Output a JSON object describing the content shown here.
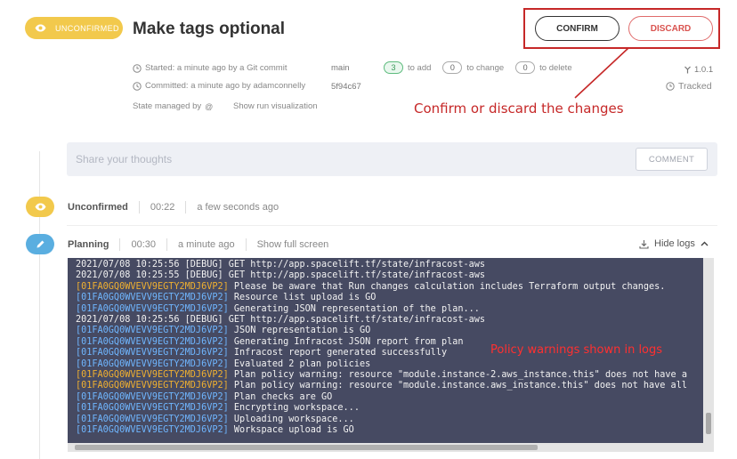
{
  "header": {
    "status": "UNCONFIRMED",
    "title": "Make tags optional",
    "confirm_label": "CONFIRM",
    "discard_label": "DISCARD",
    "annotation": "Confirm or discard the changes"
  },
  "meta": {
    "started": "Started: a minute ago by a Git commit",
    "committed": "Committed: a minute ago by adamconnelly",
    "branch": "main",
    "commit": "5f94c67",
    "state_managed": "State managed by",
    "show_viz": "Show run visualization",
    "add_count": "3",
    "add_label": "to add",
    "change_count": "0",
    "change_label": "to change",
    "delete_count": "0",
    "delete_label": "to delete",
    "version": "1.0.1",
    "tracked": "Tracked"
  },
  "comment": {
    "placeholder": "Share your thoughts",
    "button": "COMMENT"
  },
  "phases": {
    "unconfirmed": {
      "name": "Unconfirmed",
      "duration": "00:22",
      "time": "a few seconds ago"
    },
    "planning": {
      "name": "Planning",
      "duration": "00:30",
      "time": "a minute ago",
      "fullscreen": "Show full screen",
      "hide_logs": "Hide logs"
    }
  },
  "log": {
    "annotation": "Policy warnings shown in logs",
    "lines": [
      {
        "prefix": "2021/07/08 10:25:56 [DEBUG]",
        "kind": "plain",
        "msg": " GET http://app.spacelift.tf/state/infracost-aws"
      },
      {
        "prefix": "2021/07/08 10:25:55 [DEBUG]",
        "kind": "plain",
        "msg": " GET http://app.spacelift.tf/state/infracost-aws"
      },
      {
        "prefix": "[01FA0GQ0WVEVV9EGTY2MDJ6VP2]",
        "kind": "orange",
        "msg": " Please be aware that Run changes calculation includes Terraform output changes."
      },
      {
        "prefix": "[01FA0GQ0WVEVV9EGTY2MDJ6VP2]",
        "kind": "blue",
        "msg": " Resource list upload is GO"
      },
      {
        "prefix": "[01FA0GQ0WVEVV9EGTY2MDJ6VP2]",
        "kind": "blue",
        "msg": " Generating JSON representation of the plan..."
      },
      {
        "prefix": "2021/07/08 10:25:56 [DEBUG]",
        "kind": "plain",
        "msg": " GET http://app.spacelift.tf/state/infracost-aws"
      },
      {
        "prefix": "[01FA0GQ0WVEVV9EGTY2MDJ6VP2]",
        "kind": "blue",
        "msg": " JSON representation is GO"
      },
      {
        "prefix": "[01FA0GQ0WVEVV9EGTY2MDJ6VP2]",
        "kind": "blue",
        "msg": " Generating Infracost JSON report from plan"
      },
      {
        "prefix": "[01FA0GQ0WVEVV9EGTY2MDJ6VP2]",
        "kind": "blue",
        "msg": " Infracost report generated successfully"
      },
      {
        "prefix": "[01FA0GQ0WVEVV9EGTY2MDJ6VP2]",
        "kind": "blue",
        "msg": " Evaluated 2 plan policies"
      },
      {
        "prefix": "[01FA0GQ0WVEVV9EGTY2MDJ6VP2]",
        "kind": "orange",
        "msg": " Plan policy warning: resource \"module.instance-2.aws_instance.this\" does not have a"
      },
      {
        "prefix": "[01FA0GQ0WVEVV9EGTY2MDJ6VP2]",
        "kind": "orange",
        "msg": " Plan policy warning: resource \"module.instance.aws_instance.this\" does not have all"
      },
      {
        "prefix": "[01FA0GQ0WVEVV9EGTY2MDJ6VP2]",
        "kind": "blue",
        "msg": " Plan checks are GO"
      },
      {
        "prefix": "[01FA0GQ0WVEVV9EGTY2MDJ6VP2]",
        "kind": "blue",
        "msg": " Encrypting workspace..."
      },
      {
        "prefix": "[01FA0GQ0WVEVV9EGTY2MDJ6VP2]",
        "kind": "blue",
        "msg": " Uploading workspace..."
      },
      {
        "prefix": "[01FA0GQ0WVEVV9EGTY2MDJ6VP2]",
        "kind": "blue",
        "msg": " Workspace upload is GO"
      }
    ]
  },
  "colors": {
    "unconfirmed": "#f2c94c",
    "planning": "#5aaee0",
    "discard": "#d9534f",
    "annotation": "#c62828",
    "log_bg": "#464a62",
    "log_blue": "#6fb6ff",
    "log_orange": "#f0b030"
  },
  "icons": {
    "status": "eye-icon",
    "planning": "pencil-icon",
    "started": "clock-icon",
    "committed": "history-icon",
    "state": "at-icon",
    "version": "fork-icon",
    "tracked": "clock-icon",
    "hide_logs": "download-icon",
    "collapse": "chevron-up-icon"
  }
}
